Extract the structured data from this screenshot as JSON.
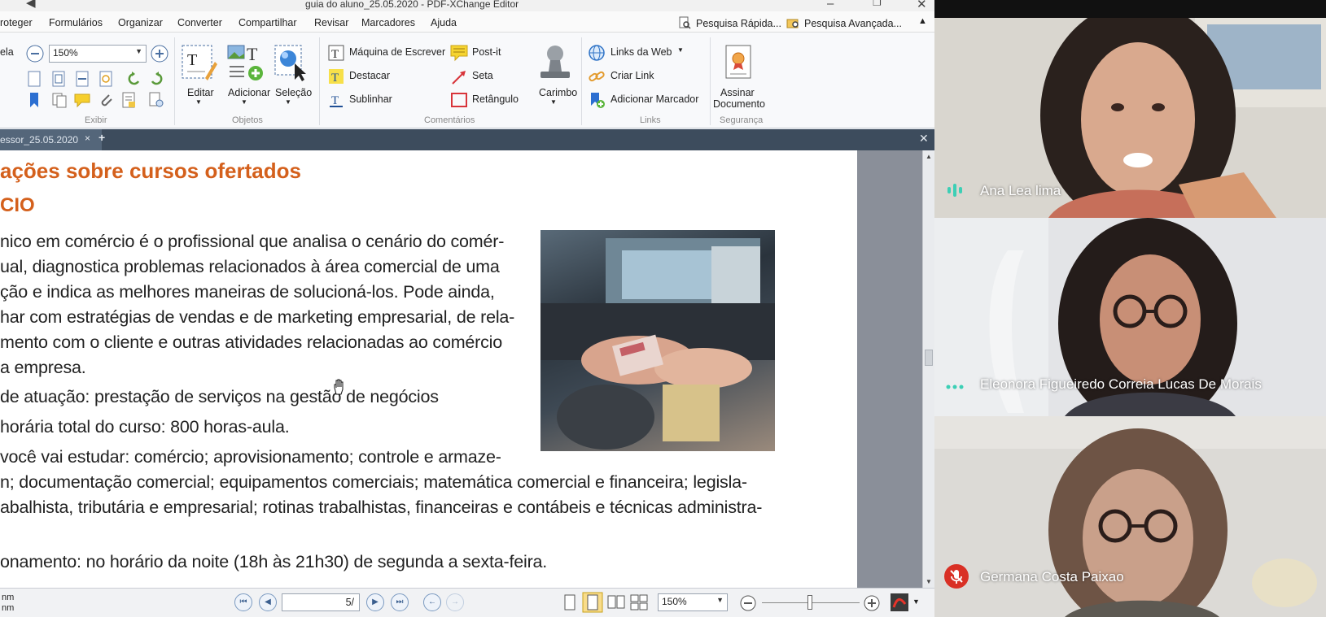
{
  "editor": {
    "window_title": "guia do aluno_25.05.2020 - PDF-XChange Editor",
    "menu": [
      "roteger",
      "Formulários",
      "Organizar",
      "Converter",
      "Compartilhar",
      "Revisar",
      "Marcadores",
      "Ajuda"
    ],
    "search": {
      "quick": "Pesquisa Rápida...",
      "advanced": "Pesquisa Avançada..."
    },
    "ribbon": {
      "left_cut_label": "ela",
      "zoom_value": "150%",
      "edit_label": "Editar",
      "add_label": "Adicionar",
      "select_label": "Seleção",
      "typewriter_label": "Máquina de Escrever",
      "highlight_label": "Destacar",
      "underline_label": "Sublinhar",
      "postit_label": "Post-it",
      "arrow_label": "Seta",
      "rectangle_label": "Retângulo",
      "stamp_label": "Carimbo",
      "weblinks_label": "Links da Web",
      "createlink_label": "Criar Link",
      "addbookmark_label": "Adicionar Marcador",
      "sign_label_1": "Assinar",
      "sign_label_2": "Documento",
      "groups": [
        "Exibir",
        "Objetos",
        "Comentários",
        "Links",
        "Segurança"
      ]
    },
    "tab": {
      "label": "essor_25.05.2020"
    },
    "document": {
      "heading": "ações sobre cursos ofertados",
      "subheading": "CIO",
      "lines": [
        "nico em comércio é o profissional que analisa o cenário do comér-",
        "ual, diagnostica problemas relacionados à área comercial de uma",
        "ção e indica as melhores maneiras de solucioná-los. Pode ainda,",
        "har com estratégias de vendas e de marketing empresarial, de rela-",
        "mento com o cliente e outras atividades relacionadas ao comércio",
        "a empresa.",
        "de atuação: prestação de serviços na gestão de negócios",
        " horária total do curso: 800 horas-aula.",
        " você vai estudar: comércio; aprovisionamento; controle e armaze-",
        "n; documentação comercial; equipamentos comerciais; matemática comercial e financeira; legisla-",
        "abalhista, tributária e empresarial; rotinas trabalhistas, financeiras e contábeis e técnicas administra-",
        "",
        "onamento: no horário da noite (18h às 21h30) de segunda a sexta-feira."
      ]
    },
    "status": {
      "left_line1": "nm",
      "left_line2": "nm",
      "page_value": "5/",
      "zoom_value": "150%"
    }
  },
  "participants": [
    {
      "name": "Ana Lea lima",
      "status": "speaking"
    },
    {
      "name": "Eleonora Figueiredo Correia Lucas De Morais",
      "status": "connected"
    },
    {
      "name": "Germana Costa Paixao",
      "status": "muted"
    }
  ],
  "colors": {
    "heading": "#d4601c",
    "tab_bar": "#3d4c5d",
    "speaking_indicator": "#3ccfb5",
    "mute_red": "#d93025"
  }
}
